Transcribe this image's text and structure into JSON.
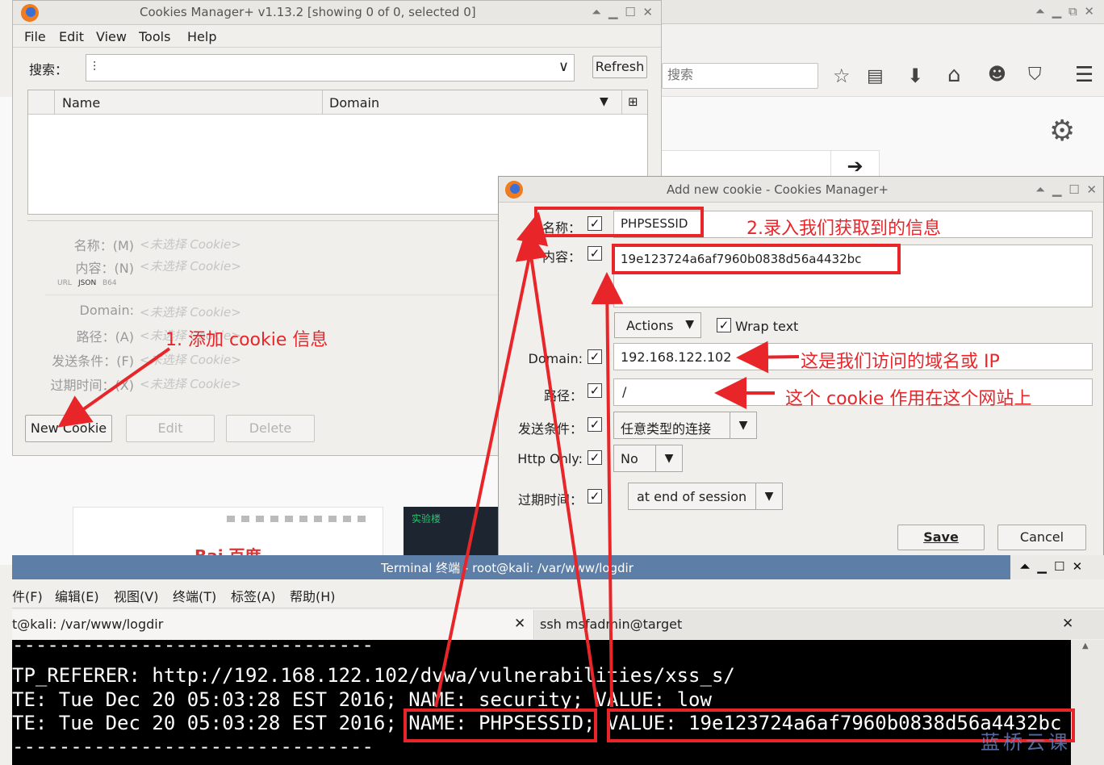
{
  "browser": {
    "search_placeholder": "搜索",
    "toolbar_icons": [
      "star-icon",
      "reading-list-icon",
      "download-icon",
      "home-icon",
      "chat-icon",
      "pocket-icon",
      "menu-icon"
    ],
    "tile1_text": "Bai 百度",
    "tile2_text": "实验楼"
  },
  "cm_window": {
    "title": "Cookies Manager+ v1.13.2 [showing 0 of 0, selected 0]",
    "menu": [
      "File",
      "Edit",
      "View",
      "Tools",
      "Help"
    ],
    "search_label": "搜索：",
    "search_value": "",
    "refresh_label": "Refresh",
    "col_name": "Name",
    "col_domain": "Domain",
    "details": [
      {
        "label": "名称：(M)",
        "value": "<未选择 Cookie>"
      },
      {
        "label": "内容：(N)",
        "value": "<未选择 Cookie>"
      },
      {
        "label": "Domain:",
        "value": "<未选择 Cookie>"
      },
      {
        "label": "路径：(A)",
        "value": "<未选择 Cookie>"
      },
      {
        "label": "发送条件：(F)",
        "value": "<未选择 Cookie>"
      },
      {
        "label": "过期时间：(X)",
        "value": "<未选择 Cookie>"
      }
    ],
    "format_tabs": [
      "URL",
      "JSON",
      "B64"
    ],
    "btn_new": "New Cookie",
    "btn_edit": "Edit",
    "btn_delete": "Delete"
  },
  "add_window": {
    "title": "Add new cookie - Cookies Manager+",
    "name_label": "名称：",
    "name_value": "PHPSESSID",
    "content_label": "内容：",
    "content_value": "19e123724a6af7960b0838d56a4432bc",
    "actions_label": "Actions",
    "wrap_label": "Wrap text",
    "domain_label": "Domain:",
    "domain_value": "192.168.122.102",
    "path_label": "路径：",
    "path_value": "/",
    "send_label": "发送条件：",
    "send_value": "任意类型的连接",
    "http_label": "Http Only:",
    "http_value": "No",
    "expire_label": "过期时间：",
    "expire_value": "at end of session",
    "save_label": "Save",
    "cancel_label": "Cancel"
  },
  "terminal": {
    "title": "Terminal 终端 - root@kali: /var/www/logdir",
    "menu": [
      "件(F)",
      "编辑(E)",
      "视图(V)",
      "终端(T)",
      "标签(A)",
      "帮助(H)"
    ],
    "tab1": "t@kali: /var/www/logdir",
    "tab2": "ssh msfadmin@target",
    "lines": [
      "-------------------------------",
      "TP_REFERER: http://192.168.122.102/dvwa/vulnerabilities/xss_s/",
      "TE: Tue Dec 20 05:03:28 EST 2016; NAME: security; VALUE: low",
      "TE: Tue Dec 20 05:03:28 EST 2016; NAME: PHPSESSID; VALUE: 19e123724a6af7960b0838d56a4432bc",
      "-------------------------------"
    ]
  },
  "annotations": {
    "step1": "1. 添加 cookie 信息",
    "step2": "2.录入我们获取到的信息",
    "domain_note": "这是我们访问的域名或 IP",
    "path_note": "这个 cookie 作用在这个网站上",
    "color": "#e8262a"
  },
  "watermark": "蓝桥云课"
}
